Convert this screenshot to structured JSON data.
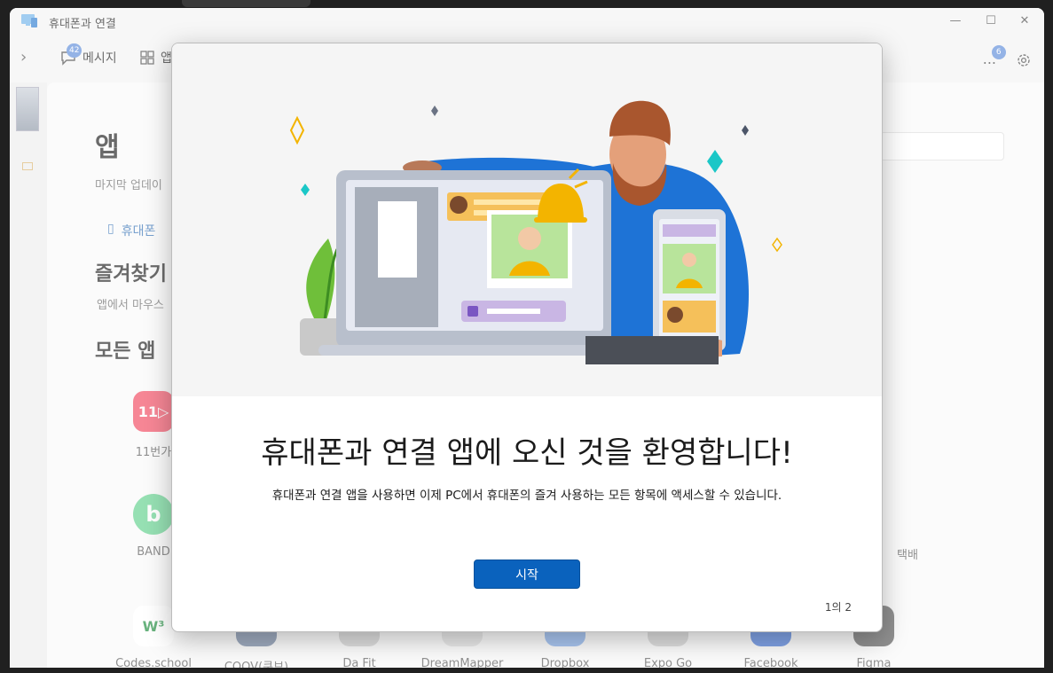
{
  "window": {
    "title": "휴대폰과 연결",
    "minimize": "—",
    "maximize": "☐",
    "close": "✕"
  },
  "nav": {
    "messages_label": "메시지",
    "messages_badge": "42",
    "apps_label": "앱",
    "more_label": "...",
    "more_badge": "6"
  },
  "main": {
    "title": "앱",
    "last_update": "마지막 업데이",
    "phone_link": "휴대폰 ",
    "favorites_title": "즐겨찾기",
    "favorites_desc": "앱에서 마우스",
    "all_apps_title": "모든 앱",
    "apps": [
      {
        "label": "11번가",
        "glyph": "11▷",
        "color": "#f2455c"
      },
      {
        "label": "BAND",
        "glyph": "b",
        "color": "#5fd08a"
      },
      {
        "label": "Codes.school",
        "glyph": "W³",
        "color": "#ffffff"
      },
      {
        "label": "COOV(쿠브)",
        "glyph": "",
        "color": "#6a7d9c"
      },
      {
        "label": "Da Fit",
        "glyph": "",
        "color": "#cccccc"
      },
      {
        "label": "DreamMapper",
        "glyph": "",
        "color": "#dddddd"
      },
      {
        "label": "Dropbox",
        "glyph": "",
        "color": "#7aa6e8"
      },
      {
        "label": "Expo Go",
        "glyph": "",
        "color": "#cccccc"
      },
      {
        "label": "Facebook",
        "glyph": "",
        "color": "#3b6fd6"
      },
      {
        "label": "Figma",
        "glyph": "",
        "color": "#555555"
      },
      {
        "label": "택배",
        "glyph": "",
        "color": "#cccccc"
      }
    ]
  },
  "dialog": {
    "title": "휴대폰과 연결 앱에 오신 것을 환영합니다!",
    "description": "휴대폰과 연결 앱을 사용하면 이제 PC에서 휴대폰의 즐겨 사용하는 모든 항목에 액세스할 수 있습니다.",
    "start_button": "시작",
    "pager": "1의 2"
  },
  "colors": {
    "accent": "#0a62bd",
    "badge": "#5b8bd9"
  }
}
